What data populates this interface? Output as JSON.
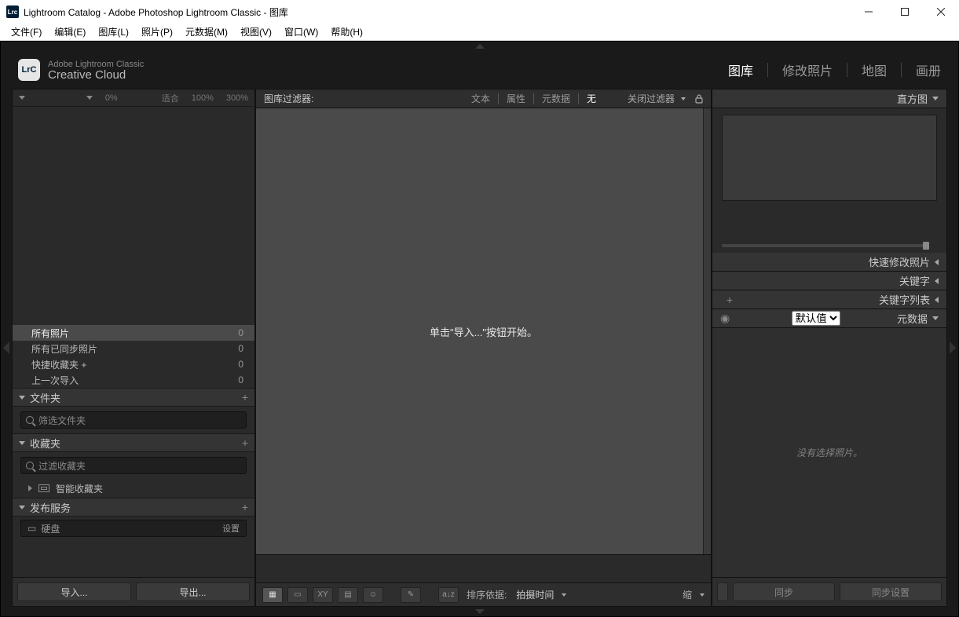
{
  "window": {
    "title": "Lightroom Catalog - Adobe Photoshop Lightroom Classic - 图库",
    "logo_text": "Lrc"
  },
  "menu": {
    "file": "文件(F)",
    "edit": "编辑(E)",
    "library": "图库(L)",
    "photo": "照片(P)",
    "metadata": "元数据(M)",
    "view": "视图(V)",
    "window": "窗口(W)",
    "help": "帮助(H)"
  },
  "branding": {
    "line1": "Adobe Lightroom Classic",
    "line2": "Creative Cloud",
    "badge": "LrC"
  },
  "modules": {
    "library": "图库",
    "develop": "修改照片",
    "map": "地图",
    "book": "画册"
  },
  "navigator": {
    "zoom_fit": "适合",
    "zoom_100": "100%",
    "zoom_300": "300%",
    "zoom_0": "0%"
  },
  "catalog": {
    "items": [
      {
        "label": "所有照片",
        "count": "0"
      },
      {
        "label": "所有已同步照片",
        "count": "0"
      },
      {
        "label": "快捷收藏夹 +",
        "count": "0"
      },
      {
        "label": "上一次导入",
        "count": "0"
      }
    ]
  },
  "folders": {
    "title": "文件夹",
    "filter_placeholder": "筛选文件夹"
  },
  "collections": {
    "title": "收藏夹",
    "filter_placeholder": "过滤收藏夹",
    "smart": "智能收藏夹"
  },
  "publish": {
    "title": "发布服务",
    "hd_row": "硬盘",
    "hd_config": "设置"
  },
  "left_buttons": {
    "import": "导入...",
    "export": "导出..."
  },
  "filter_bar": {
    "title": "图库过滤器:",
    "text": "文本",
    "attr": "属性",
    "meta": "元数据",
    "none": "无",
    "off": "关闭过滤器"
  },
  "canvas": {
    "message": "单击\"导入...\"按钮开始。"
  },
  "toolbar": {
    "sort_label": "排序依据:",
    "sort_value": "拍摄时间",
    "thumb_label": "缩"
  },
  "right": {
    "histogram": "直方图",
    "quick_dev": "快速修改照片",
    "keywording": "关键字",
    "keyword_list": "关键字列表",
    "metadata": "元数据",
    "preset_default": "默认值",
    "no_photo": "没有选择照片。",
    "sync": "同步",
    "sync_settings": "同步设置"
  }
}
